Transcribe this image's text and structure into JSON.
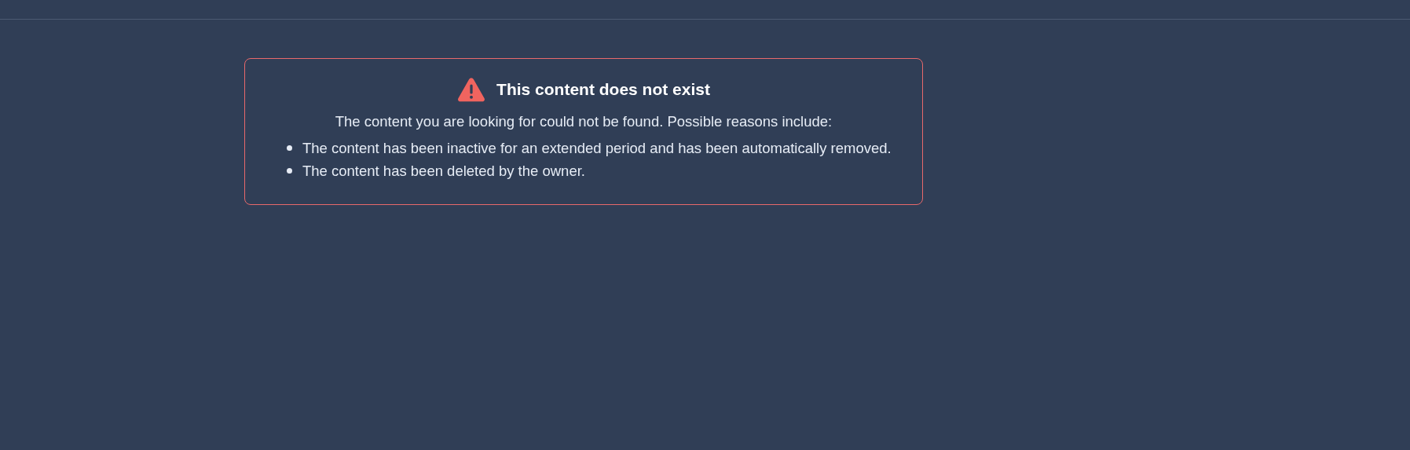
{
  "notice": {
    "title": "This content does not exist",
    "message": "The content you are looking for could not be found. Possible reasons include:",
    "reasons": [
      "The content has been inactive for an extended period and has been automatically removed.",
      "The content has been deleted by the owner."
    ]
  }
}
